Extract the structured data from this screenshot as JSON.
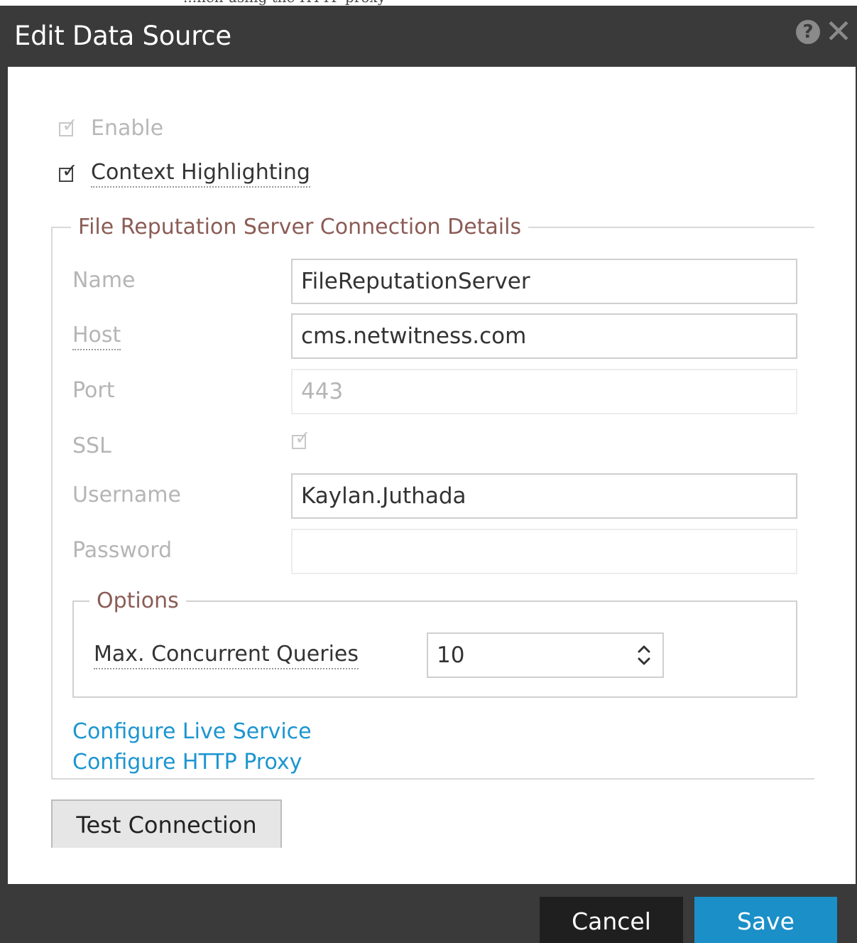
{
  "window": {
    "clipped_text": "...hen using the HTTP proxy",
    "title": "Edit Data Source",
    "help_glyph": "?",
    "close_glyph": "✕"
  },
  "checkboxes": {
    "enable": {
      "label": "Enable",
      "checked": true,
      "disabled": true
    },
    "context_highlighting": {
      "label": "Context Highlighting",
      "checked": true,
      "disabled": false
    }
  },
  "connection": {
    "legend": "File Reputation Server Connection Details",
    "fields": {
      "name": {
        "label": "Name",
        "value": "FileReputationServer"
      },
      "host": {
        "label": "Host",
        "value": "cms.netwitness.com"
      },
      "port": {
        "label": "Port",
        "value": "443"
      },
      "ssl": {
        "label": "SSL",
        "checked": true,
        "disabled": true
      },
      "username": {
        "label": "Username",
        "value": "Kaylan.Juthada"
      },
      "password": {
        "label": "Password",
        "value": ""
      }
    }
  },
  "options": {
    "legend": "Options",
    "max_concurrent_queries": {
      "label": "Max. Concurrent Queries",
      "value": "10"
    }
  },
  "links": {
    "configure_live": "Configure Live Service",
    "configure_proxy": "Configure HTTP Proxy"
  },
  "buttons": {
    "test_connection": "Test Connection",
    "cancel": "Cancel",
    "save": "Save"
  },
  "colors": {
    "titlebar": "#3a3a3a",
    "legend": "#8b5c55",
    "link": "#1c95d0",
    "save": "#1b8fc8"
  }
}
